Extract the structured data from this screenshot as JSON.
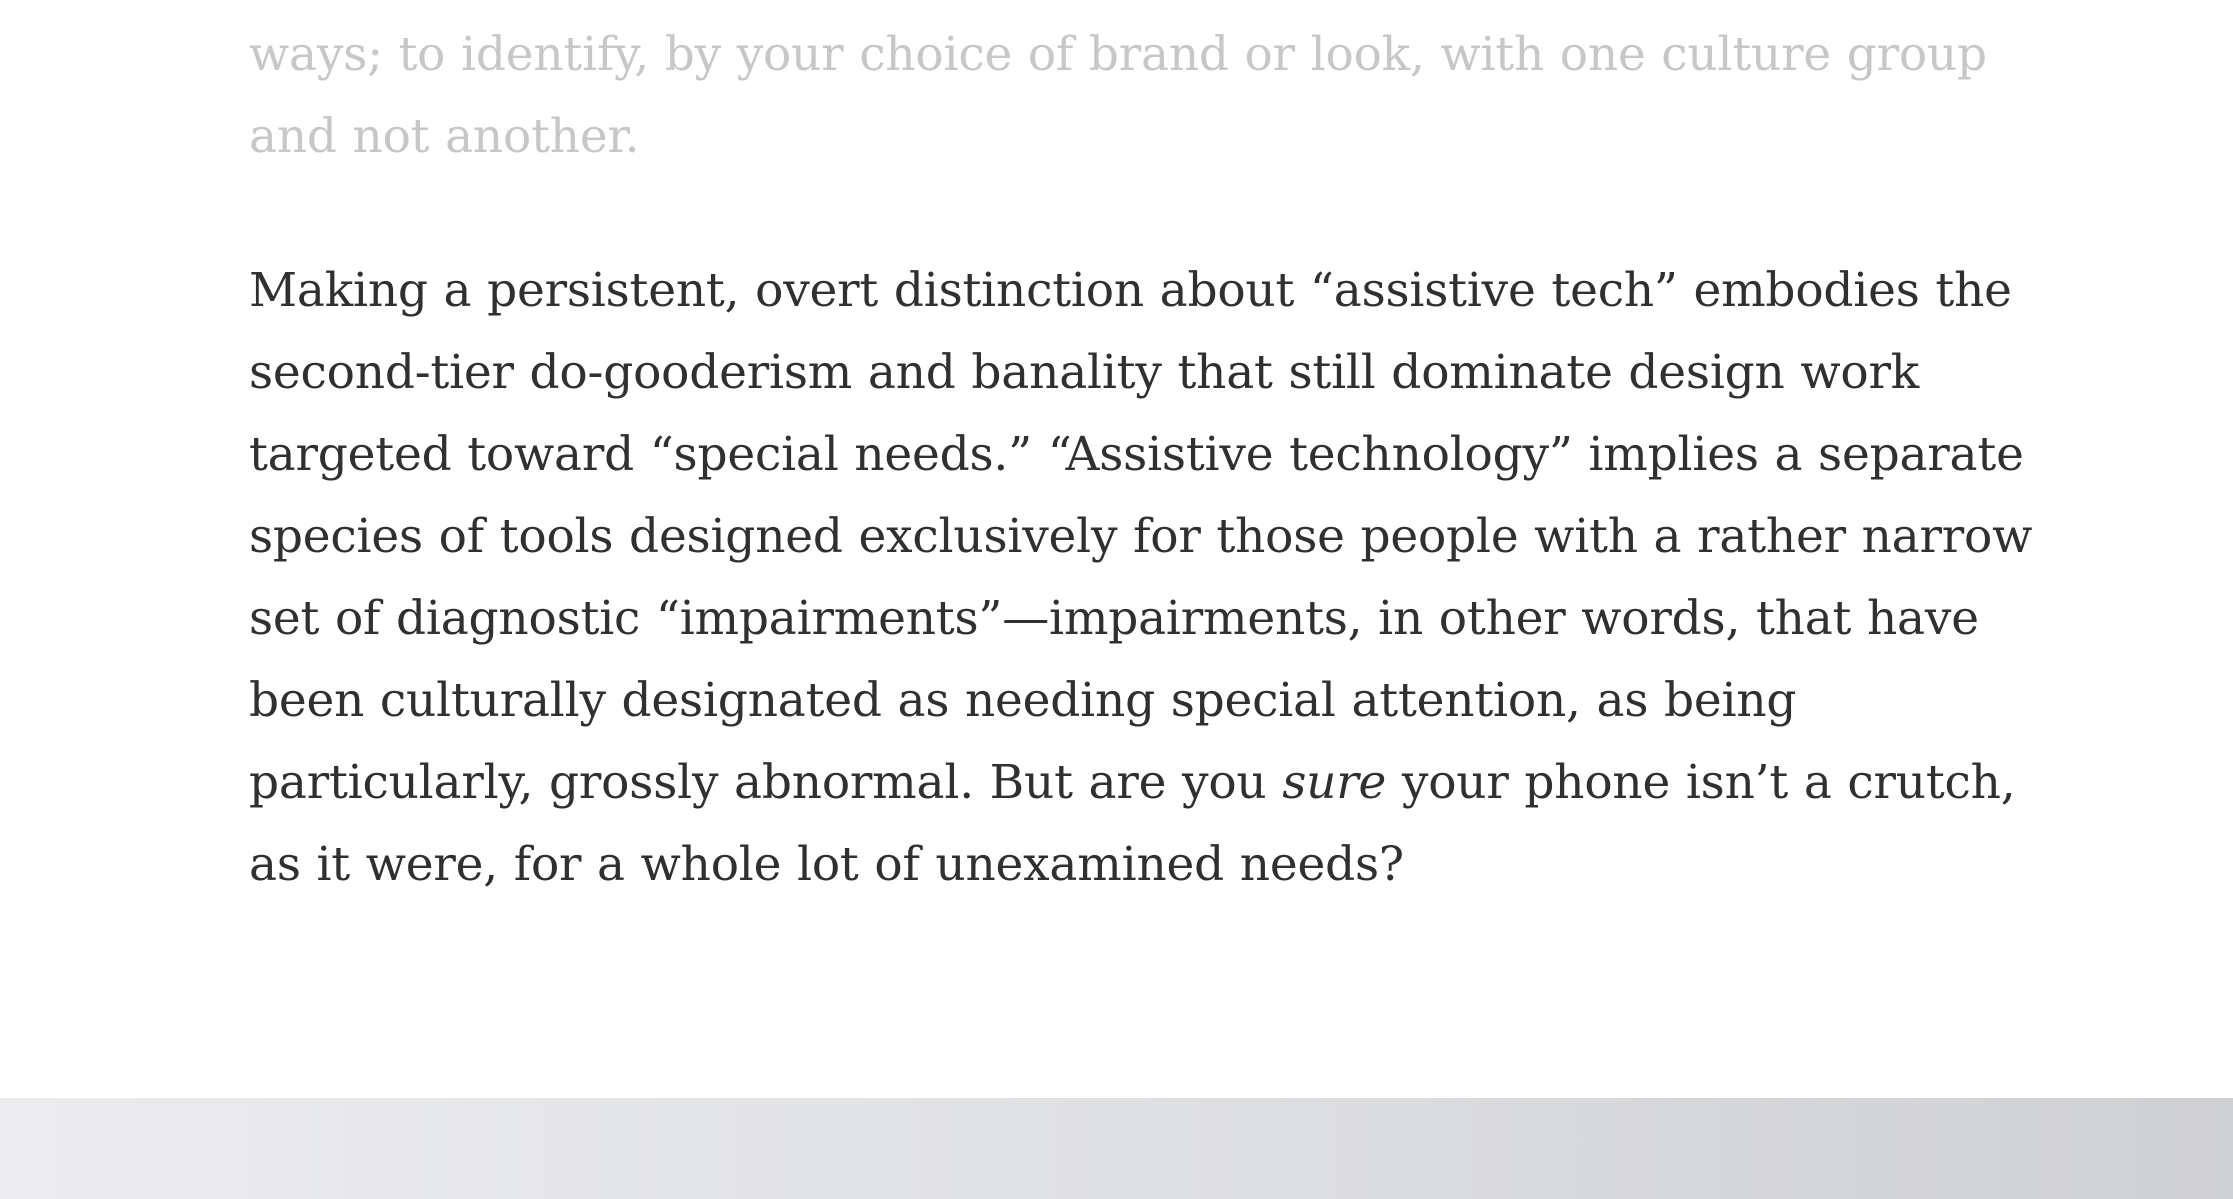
{
  "article": {
    "faded_paragraph": "ways; to identify, by your choice of brand or look, with one culture group and not another.",
    "main_paragraph": {
      "before_emphasis": "Making a persistent, overt distinction about “assistive tech” embodies the second-tier do-gooderism and banality that still dominate design work targeted toward “special needs.” “Assistive technology” implies a separate species of tools designed exclusively for those people with a rather narrow set of diagnostic “impairments”—impairments, in other words, that have been culturally designated as needing special attention, as being particularly, grossly abnormal. But are you ",
      "emphasis": "sure",
      "after_emphasis": " your phone isn’t a crutch, as it were, for a whole lot of unexamined needs?"
    }
  },
  "colors": {
    "faded_text": "#c7c7c7",
    "body_text": "#303030",
    "background": "#ffffff",
    "footer_bar": "#d8d9dc"
  }
}
